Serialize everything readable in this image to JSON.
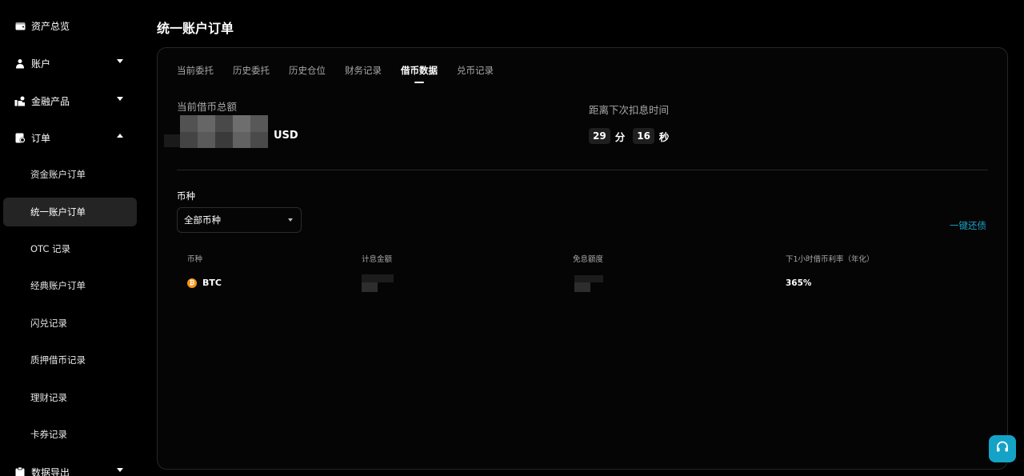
{
  "sidebar": {
    "items": [
      {
        "label": "资产总览",
        "icon": "wallet-icon"
      },
      {
        "label": "账户",
        "icon": "user-icon"
      },
      {
        "label": "金融产品",
        "icon": "finance-icon"
      },
      {
        "label": "订单",
        "icon": "order-icon"
      }
    ],
    "sub_items": [
      {
        "label": "资金账户订单"
      },
      {
        "label": "统一账户订单"
      },
      {
        "label": "OTC 记录"
      },
      {
        "label": "经典账户订单"
      },
      {
        "label": "闪兑记录"
      },
      {
        "label": "质押借币记录"
      },
      {
        "label": "理财记录"
      },
      {
        "label": "卡券记录"
      }
    ],
    "export": {
      "label": "数据导出",
      "icon": "clipboard-icon"
    }
  },
  "page": {
    "title": "统一账户订单"
  },
  "tabs": [
    "当前委托",
    "历史委托",
    "历史仓位",
    "财务记录",
    "借币数据",
    "兑币记录"
  ],
  "active_tab": "借币数据",
  "summary": {
    "total_label": "当前借币总额",
    "unit": "USD",
    "next_label": "距离下次扣息时间",
    "minutes": "29",
    "minutes_unit": "分",
    "seconds": "16",
    "seconds_unit": "秒"
  },
  "filter": {
    "label": "币种",
    "selected": "全部币种",
    "repay_label": "一键还债"
  },
  "table": {
    "headers": [
      "币种",
      "计息金额",
      "免息额度",
      "下1小时借币利率（年化）"
    ],
    "rows": [
      {
        "coin": "BTC",
        "rate": "365%"
      }
    ]
  },
  "colors": {
    "accent": "#14a3c7",
    "btc": "#f7931a",
    "background": "#000000"
  }
}
